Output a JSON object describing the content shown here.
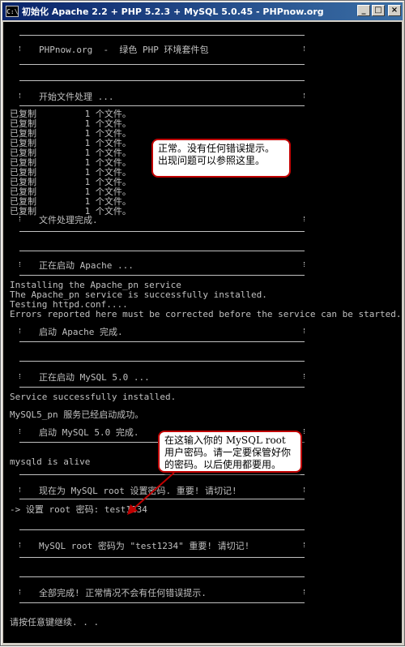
{
  "window": {
    "title": "初始化 Apache 2.2 + PHP 5.2.3 + MySQL 5.0.45 - PHPnow.org",
    "icon": "cmd-icon",
    "icon_label": "C:\\",
    "buttons": {
      "minimize": "_",
      "maximize": "□",
      "close": "×"
    }
  },
  "console": {
    "header": "PHPnow.org  -  绿色 PHP 环境套件包",
    "start_files": "开始文件处理 ...",
    "copied": [
      "已复制         1 个文件。",
      "已复制         1 个文件。",
      "已复制         1 个文件。",
      "已复制         1 个文件。",
      "已复制         1 个文件。",
      "已复制         1 个文件。",
      "已复制         1 个文件。",
      "已复制         1 个文件。",
      "已复制         1 个文件。",
      "已复制         1 个文件。",
      "已复制         1 个文件。"
    ],
    "files_done": "文件处理完成.",
    "apache_starting": "正在启动 Apache ...",
    "apache_log": [
      "Installing the Apache_pn service",
      "The Apache_pn service is successfully installed.",
      "Testing httpd.conf....",
      "Errors reported here must be corrected before the service can be started."
    ],
    "apache_done": "启动 Apache 完成.",
    "mysql_starting": "正在启动 MySQL 5.0 ...",
    "mysql_installed": "Service successfully installed.",
    "mysql_started": "MySQL5_pn 服务已经启动成功。",
    "mysql_done": "启动 MySQL 5.0 完成.",
    "mysqld_alive": "mysqld is alive",
    "set_pwd_notice": "现在为 MySQL root 设置密码. 重要! 请切记!",
    "pwd_prompt": "-> 设置 root 密码: test1234",
    "pwd_result": "MySQL root 密码为 \"test1234\" 重要! 请切记!",
    "all_done": "全部完成! 正常情况不会有任何错误提示.",
    "press_key": "请按任意键继续. . ."
  },
  "callouts": {
    "normal": [
      "正常。没有任何错误提示。",
      "出现问题可以参照这里。"
    ],
    "password": [
      "在这输入你的 MySQL root",
      "用户密码。请一定要保管好你",
      "的密码。以后使用都要用。"
    ]
  },
  "colors": {
    "console_bg": "#000000",
    "console_fg": "#c0c0c0",
    "callout_border": "#c00000",
    "titlebar": "#0a246a"
  }
}
